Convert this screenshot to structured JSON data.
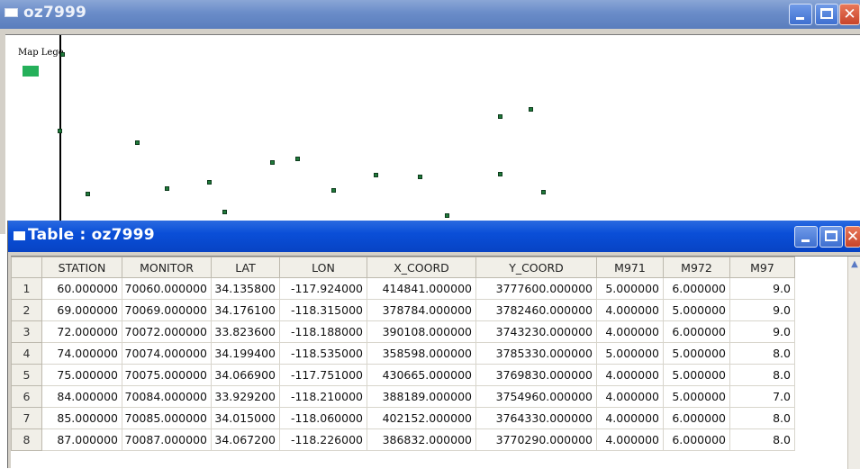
{
  "map_window": {
    "title": "oz7999",
    "legend_label": "Map Lege",
    "legend_color": "#25b05a",
    "point_color": "#1f7a3a",
    "controls": {
      "minimize": "minimize-icon",
      "maximize": "maximize-icon",
      "close": "close-icon"
    }
  },
  "table_window": {
    "title": "Table : oz7999",
    "columns": [
      "STATION",
      "MONITOR",
      "LAT",
      "LON",
      "X_COORD",
      "Y_COORD",
      "M971",
      "M972",
      "M97"
    ],
    "rows": [
      {
        "n": "1",
        "cells": [
          "60.000000",
          "70060.000000",
          "34.135800",
          "-117.924000",
          "414841.000000",
          "3777600.000000",
          "5.000000",
          "6.000000",
          "9.0"
        ]
      },
      {
        "n": "2",
        "cells": [
          "69.000000",
          "70069.000000",
          "34.176100",
          "-118.315000",
          "378784.000000",
          "3782460.000000",
          "4.000000",
          "5.000000",
          "9.0"
        ]
      },
      {
        "n": "3",
        "cells": [
          "72.000000",
          "70072.000000",
          "33.823600",
          "-118.188000",
          "390108.000000",
          "3743230.000000",
          "4.000000",
          "6.000000",
          "9.0"
        ]
      },
      {
        "n": "4",
        "cells": [
          "74.000000",
          "70074.000000",
          "34.199400",
          "-118.535000",
          "358598.000000",
          "3785330.000000",
          "5.000000",
          "5.000000",
          "8.0"
        ]
      },
      {
        "n": "5",
        "cells": [
          "75.000000",
          "70075.000000",
          "34.066900",
          "-117.751000",
          "430665.000000",
          "3769830.000000",
          "4.000000",
          "5.000000",
          "8.0"
        ]
      },
      {
        "n": "6",
        "cells": [
          "84.000000",
          "70084.000000",
          "33.929200",
          "-118.210000",
          "388189.000000",
          "3754960.000000",
          "4.000000",
          "5.000000",
          "7.0"
        ]
      },
      {
        "n": "7",
        "cells": [
          "85.000000",
          "70085.000000",
          "34.015000",
          "-118.060000",
          "402152.000000",
          "3764330.000000",
          "4.000000",
          "6.000000",
          "8.0"
        ]
      },
      {
        "n": "8",
        "cells": [
          "87.000000",
          "70087.000000",
          "34.067200",
          "-118.226000",
          "386832.000000",
          "3770290.000000",
          "4.000000",
          "6.000000",
          "8.0"
        ]
      }
    ],
    "controls": {
      "minimize": "minimize-icon",
      "maximize": "maximize-icon",
      "close": "close-icon"
    }
  }
}
